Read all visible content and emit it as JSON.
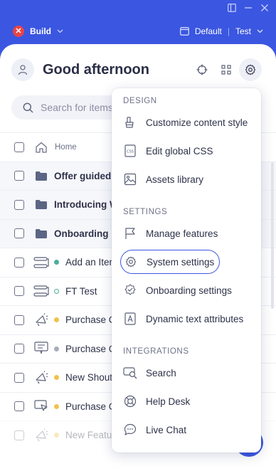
{
  "window": {
    "icons": [
      "panel-icon",
      "minimize-icon",
      "close-icon"
    ]
  },
  "header": {
    "build_label": "Build",
    "environment": "Default",
    "env_separator": "|",
    "workspace": "Test"
  },
  "greeting": "Good afternoon",
  "search": {
    "placeholder": "Search for items"
  },
  "list": {
    "home_label": "Home",
    "rows": [
      {
        "label": "Offer guided",
        "type": "folder"
      },
      {
        "label": "Introducing W",
        "type": "folder"
      },
      {
        "label": "Onboarding",
        "type": "folder"
      },
      {
        "label": "Add an Iten",
        "type": "item",
        "icon": "flow-icon",
        "status": "published",
        "status_color": "#4cae9a"
      },
      {
        "label": "FT Test",
        "type": "item",
        "icon": "flow-icon",
        "status": "draft",
        "status_color": "#4cae9a"
      },
      {
        "label": "Purchase C",
        "type": "item",
        "icon": "megaphone-icon",
        "status": "pending",
        "status_color": "#f0c24b"
      },
      {
        "label": "Purchase C",
        "type": "item",
        "icon": "tooltip-icon",
        "status": "inactive",
        "status_color": "#a8adbd"
      },
      {
        "label": "New Shout",
        "type": "item",
        "icon": "megaphone-icon",
        "status": "pending",
        "status_color": "#f0c24b"
      },
      {
        "label": "Purchase C",
        "type": "item",
        "icon": "cursor-icon",
        "status": "pending",
        "status_color": "#f0c24b"
      },
      {
        "label": "New Featu",
        "type": "item",
        "icon": "megaphone-icon",
        "status": "pending",
        "status_color": "#f0c24b"
      }
    ]
  },
  "menu": {
    "sections": [
      {
        "title": "DESIGN",
        "items": [
          {
            "label": "Customize content style",
            "icon": "paint-bucket-icon"
          },
          {
            "label": "Edit global CSS",
            "icon": "css-file-icon"
          },
          {
            "label": "Assets library",
            "icon": "image-icon"
          }
        ]
      },
      {
        "title": "SETTINGS",
        "items": [
          {
            "label": "Manage features",
            "icon": "flag-icon"
          },
          {
            "label": "System settings",
            "icon": "gear-icon",
            "highlighted": true
          },
          {
            "label": "Onboarding settings",
            "icon": "badge-check-icon"
          },
          {
            "label": "Dynamic text attributes",
            "icon": "text-attribute-icon"
          }
        ]
      },
      {
        "title": "INTEGRATIONS",
        "items": [
          {
            "label": "Search",
            "icon": "search-integration-icon"
          },
          {
            "label": "Help Desk",
            "icon": "lifebuoy-icon"
          },
          {
            "label": "Live Chat",
            "icon": "chat-bubble-icon"
          }
        ]
      }
    ]
  },
  "colors": {
    "brand": "#3b56e0",
    "build_status": "#e84545"
  }
}
